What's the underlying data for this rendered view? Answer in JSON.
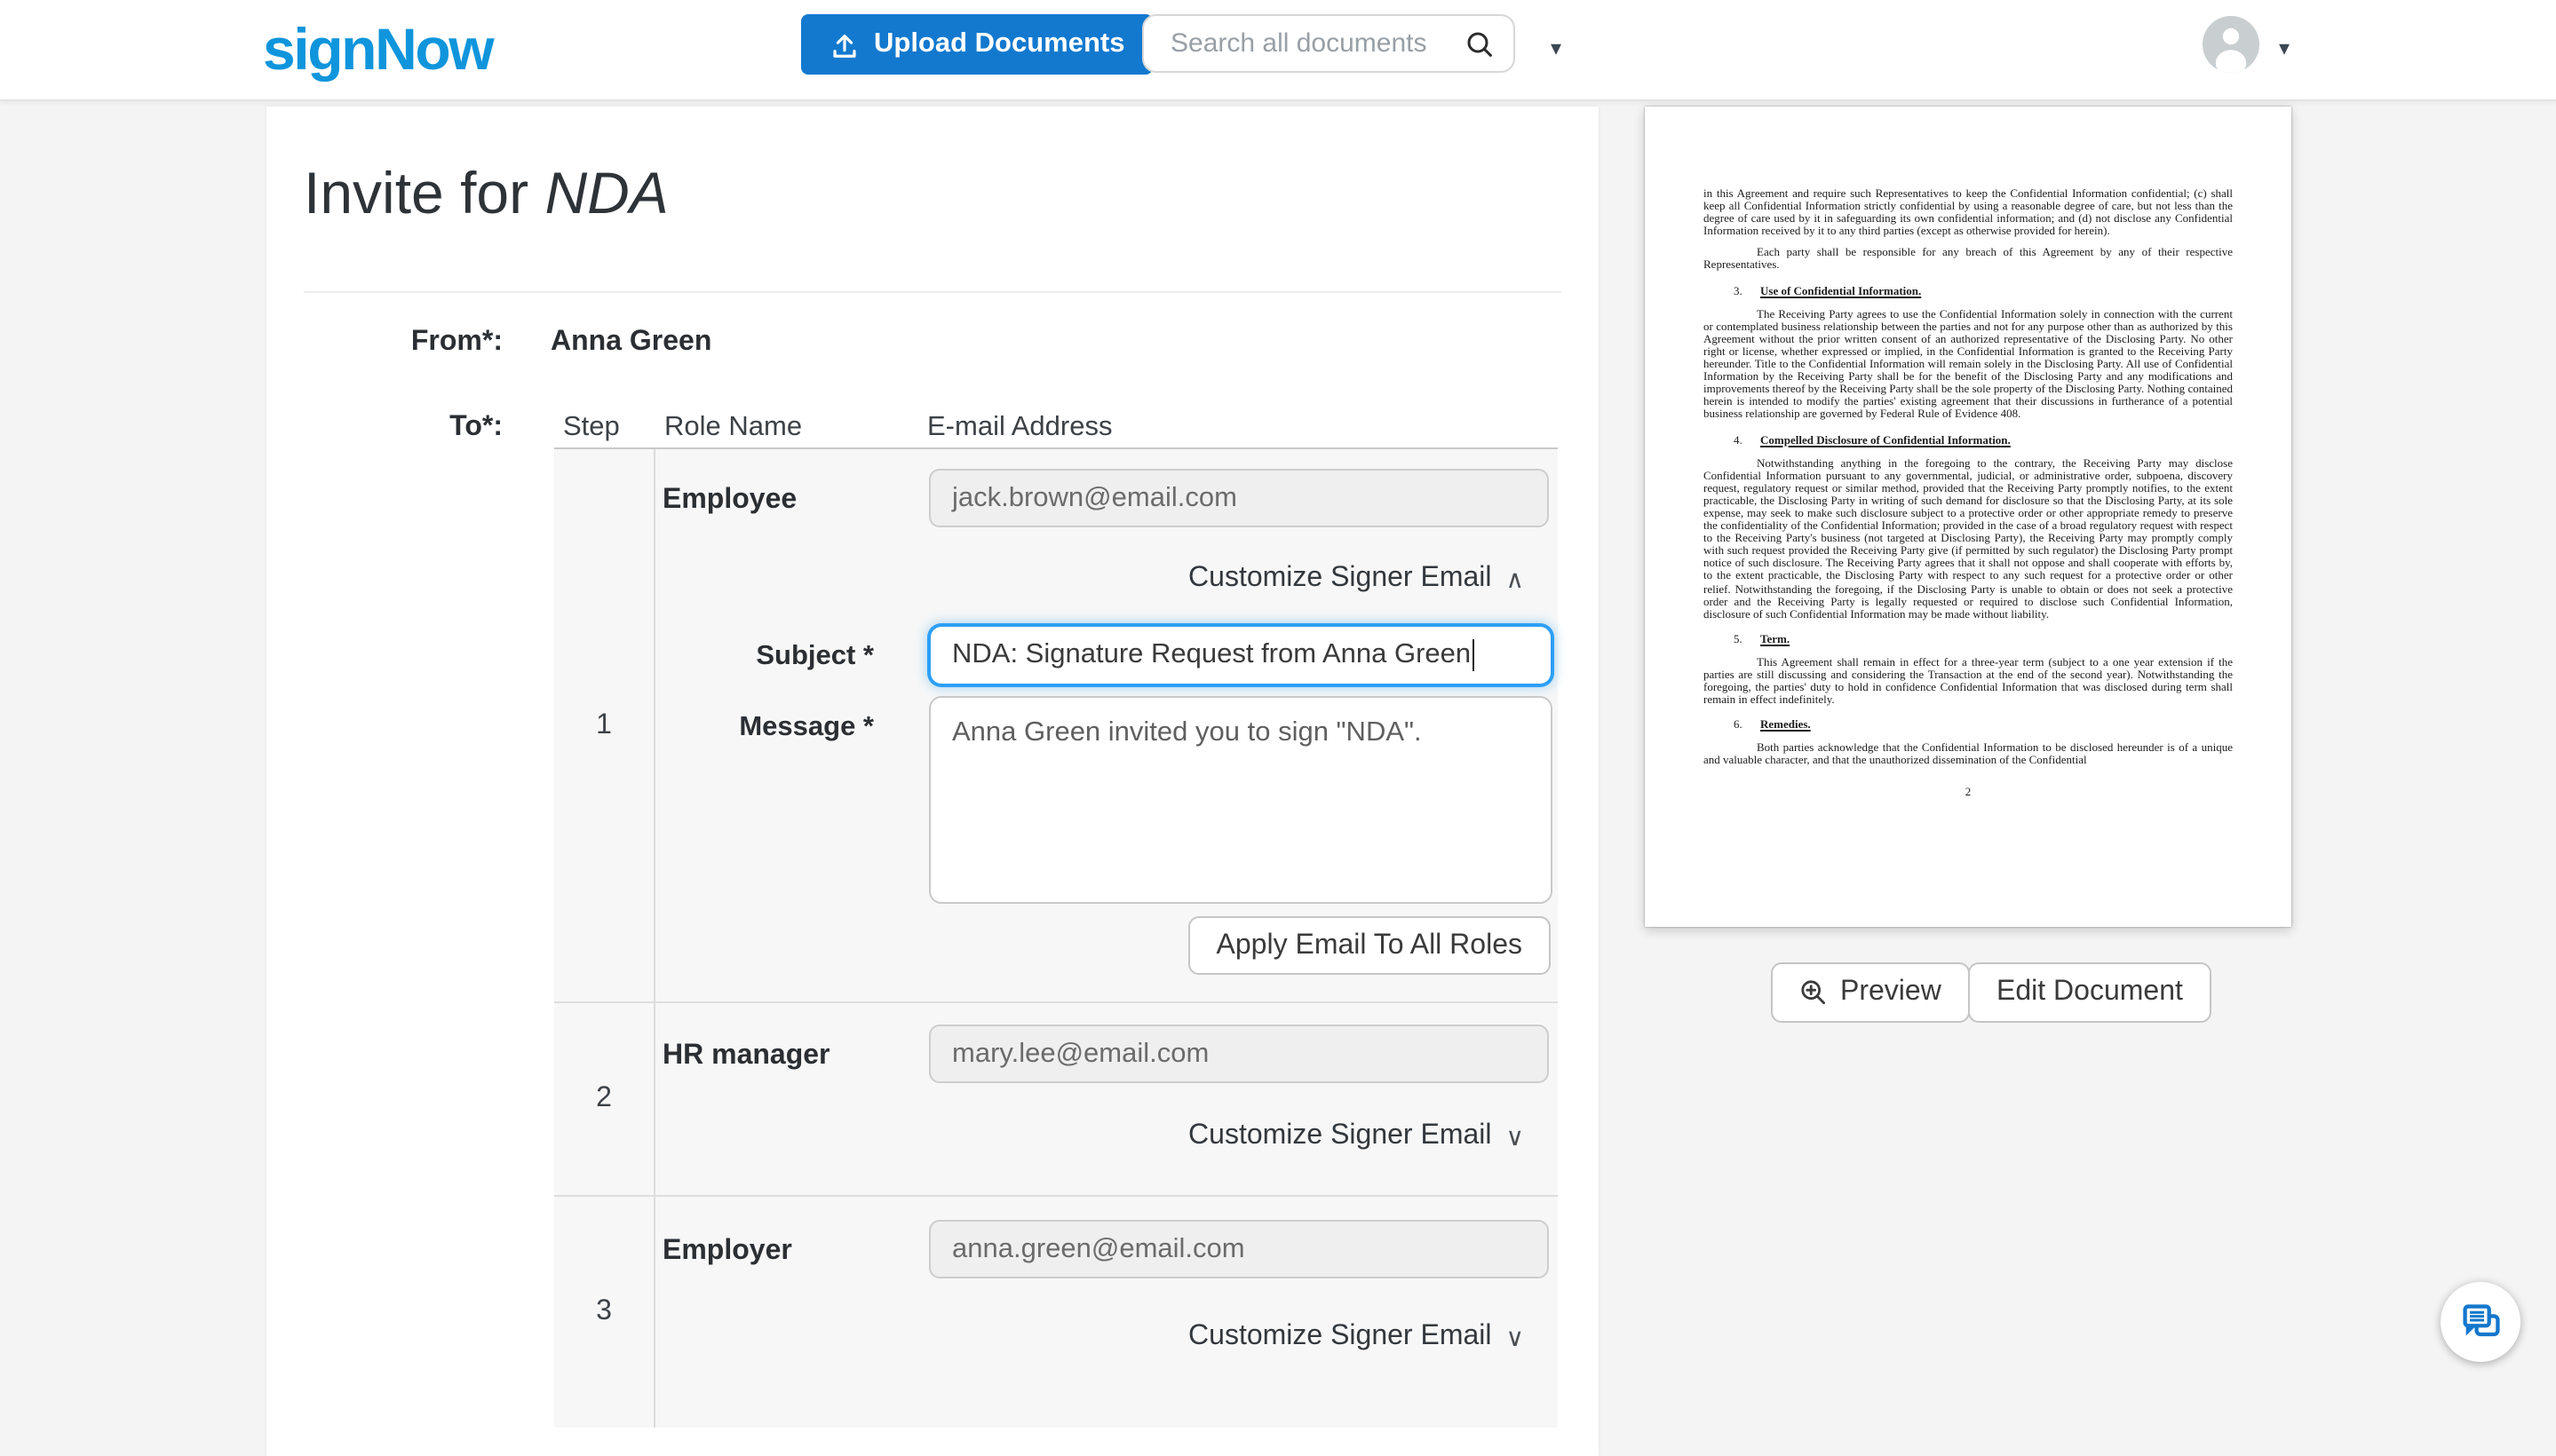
{
  "header": {
    "logo": "signNow",
    "upload_button": "Upload Documents",
    "search_placeholder": "Search all documents",
    "colors": {
      "brand_logo_blue": "#1095dc",
      "button_blue": "#1379cf",
      "focus_blue": "#2e9ff5",
      "chat_icon_blue": "#1377cc"
    }
  },
  "icons": {
    "caret_down": "▾",
    "chevron_up": "∧",
    "chevron_down": "∨"
  },
  "invite": {
    "title_prefix": "Invite for ",
    "title_doc": "NDA",
    "from_label": "From*:",
    "from_value": "Anna Green",
    "to_label": "To*:",
    "columns": {
      "step": "Step",
      "role": "Role Name",
      "email": "E-mail Address"
    },
    "customize_label": "Customize Signer Email",
    "rows": [
      {
        "step": "1",
        "role": "Employee",
        "email": "jack.brown@email.com"
      },
      {
        "step": "2",
        "role": "HR manager",
        "email": "mary.lee@email.com"
      },
      {
        "step": "3",
        "role": "Employer",
        "email": "anna.green@email.com"
      }
    ],
    "subject_label": "Subject *",
    "subject_value": "NDA: Signature Request from Anna Green",
    "message_label": "Message *",
    "message_value": "Anna Green invited you to sign \"NDA\".",
    "apply_button": "Apply Email To All Roles"
  },
  "document_panel": {
    "preview_button": "Preview",
    "edit_button": "Edit Document",
    "page": {
      "number": "2",
      "blocks": [
        {
          "text": "in this Agreement and require such Representatives to keep the Confidential Information confidential; (c) shall keep all Confidential Information strictly confidential by using a reasonable degree of care, but not less than the degree of care used by it in safeguarding its own confidential information; and (d) not disclose any Confidential Information received by it to any third parties (except as otherwise provided for herein)."
        },
        {
          "text": "Each party shall be responsible for any breach of this Agreement by any of their respective Representatives."
        },
        {
          "num": "3.",
          "heading": "Use of Confidential Information."
        },
        {
          "text": "The Receiving Party agrees to use the Confidential Information solely in connection with the current or contemplated business relationship between the parties and not for any purpose other than as authorized by this Agreement without the prior written consent of an authorized representative of the Disclosing Party.  No other right or license, whether expressed or implied, in the Confidential Information is granted to the Receiving Party hereunder.  Title to the Confidential Information will remain solely in the Disclosing Party.  All use of Confidential Information by the Receiving Party shall be for the benefit of the Disclosing Party and any modifications and improvements thereof by the Receiving Party shall be the sole property of the Disclosing Party.  Nothing contained herein is intended to modify the parties' existing agreement that their discussions in furtherance of a potential business relationship are governed by Federal Rule of Evidence 408."
        },
        {
          "num": "4.",
          "heading": "Compelled Disclosure of Confidential Information."
        },
        {
          "text": "Notwithstanding anything in the foregoing to the contrary, the Receiving Party may disclose Confidential Information pursuant to any governmental, judicial, or administrative order, subpoena, discovery request, regulatory request or similar method, provided that the Receiving Party promptly notifies, to the extent practicable, the Disclosing Party in writing of such demand for disclosure so that the Disclosing Party, at its sole expense, may seek to make such disclosure subject to a protective order or other appropriate remedy to preserve the confidentiality of the Confidential Information; provided in the case of a broad regulatory request with respect to the Receiving Party's business (not targeted at Disclosing Party), the Receiving Party may promptly comply with such request provided the Receiving Party give (if permitted by such regulator) the Disclosing Party prompt notice of such disclosure.  The Receiving Party agrees that it shall not oppose and shall cooperate with efforts by, to the extent practicable, the Disclosing Party with respect to any such request for a protective order or other relief.  Notwithstanding the foregoing, if the Disclosing Party is unable to obtain or does not seek a protective order and the Receiving Party is legally requested or required to disclose such Confidential Information, disclosure of such Confidential Information may be made without liability."
        },
        {
          "num": "5.",
          "heading": "Term."
        },
        {
          "text": "This Agreement shall remain in effect for a three-year term (subject to a one year extension if the parties are still discussing and considering the Transaction at the end of the second year).  Notwithstanding the foregoing, the parties' duty to hold in confidence Confidential Information that was disclosed during term shall remain in effect indefinitely."
        },
        {
          "num": "6.",
          "heading": "Remedies."
        },
        {
          "text": "Both parties acknowledge that the Confidential Information to be disclosed hereunder is of a unique and valuable character, and that the unauthorized dissemination of the Confidential"
        }
      ]
    }
  }
}
